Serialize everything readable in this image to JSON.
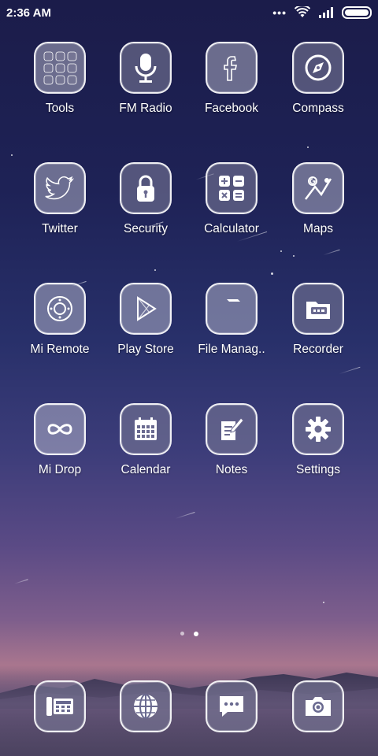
{
  "status_bar": {
    "time": "2:36 AM",
    "icons": [
      "more-dots-icon",
      "wifi-icon",
      "signal-icon",
      "battery-icon"
    ]
  },
  "apps": [
    {
      "label": "Tools",
      "icon": "folder-grid-icon"
    },
    {
      "label": "FM Radio",
      "icon": "microphone-icon"
    },
    {
      "label": "Facebook",
      "icon": "facebook-icon"
    },
    {
      "label": "Compass",
      "icon": "compass-icon"
    },
    {
      "label": "Twitter",
      "icon": "twitter-bird-icon"
    },
    {
      "label": "Security",
      "icon": "padlock-icon"
    },
    {
      "label": "Calculator",
      "icon": "calculator-icon"
    },
    {
      "label": "Maps",
      "icon": "map-icon"
    },
    {
      "label": "Mi Remote",
      "icon": "remote-icon"
    },
    {
      "label": "Play Store",
      "icon": "play-store-icon"
    },
    {
      "label": "File Manag..",
      "icon": "folder-icon"
    },
    {
      "label": "Recorder",
      "icon": "recorder-icon"
    },
    {
      "label": "Mi Drop",
      "icon": "infinity-icon"
    },
    {
      "label": "Calendar",
      "icon": "calendar-icon"
    },
    {
      "label": "Notes",
      "icon": "notes-icon"
    },
    {
      "label": "Settings",
      "icon": "gear-icon"
    }
  ],
  "dock": [
    {
      "icon": "phone-icon"
    },
    {
      "icon": "browser-globe-icon"
    },
    {
      "icon": "messaging-icon"
    },
    {
      "icon": "camera-icon"
    }
  ],
  "pages": {
    "count": 2,
    "active": 2
  }
}
